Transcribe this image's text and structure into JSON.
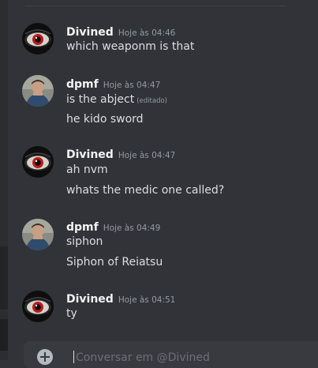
{
  "messages": [
    {
      "author": "Divined",
      "timestamp": "Hoje às 04:46",
      "avatar_icon": "eye-avatar",
      "lines": [
        {
          "text": "which weaponm is that"
        }
      ]
    },
    {
      "author": "dpmf",
      "timestamp": "Hoje às 04:47",
      "avatar_icon": "person-photo-avatar",
      "lines": [
        {
          "text": "is the abject",
          "edited": "(editado)"
        },
        {
          "text": "he kido sword"
        }
      ]
    },
    {
      "author": "Divined",
      "timestamp": "Hoje às 04:47",
      "avatar_icon": "eye-avatar",
      "lines": [
        {
          "text": "ah nvm"
        },
        {
          "text": "whats the medic one called?"
        }
      ]
    },
    {
      "author": "dpmf",
      "timestamp": "Hoje às 04:49",
      "avatar_icon": "person-photo-avatar",
      "lines": [
        {
          "text": "siphon"
        },
        {
          "text": "Siphon of Reiatsu"
        }
      ]
    },
    {
      "author": "Divined",
      "timestamp": "Hoje às 04:51",
      "avatar_icon": "eye-avatar",
      "lines": [
        {
          "text": "ty"
        }
      ]
    }
  ],
  "composer": {
    "placeholder": "Conversar em @Divined",
    "add_icon": "plus-circle-icon"
  },
  "colors": {
    "background": "#313338",
    "username": "#f2f3f5",
    "message_text": "#dbdee1",
    "timestamp": "#949ba4"
  }
}
